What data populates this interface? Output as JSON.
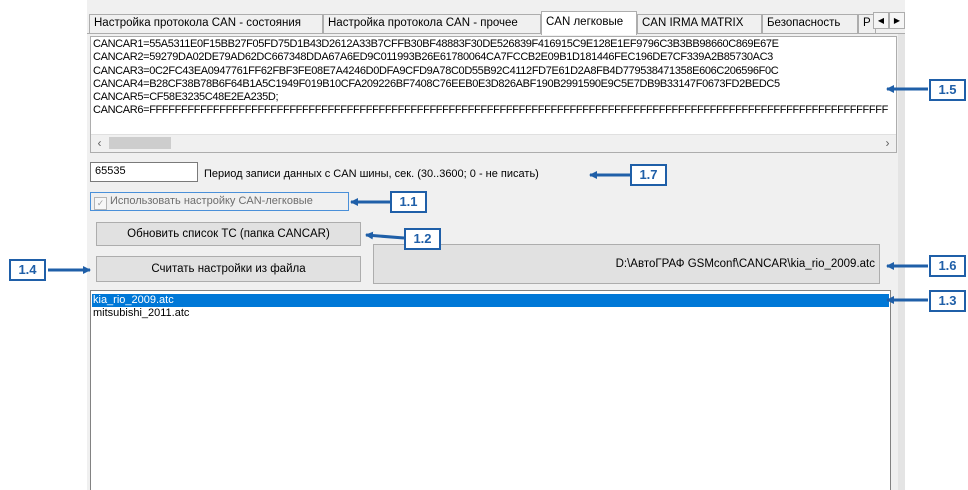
{
  "tabs": [
    {
      "label": "Настройка протокола CAN - состояния",
      "active": false
    },
    {
      "label": "Настройка протокола CAN - прочее",
      "active": false
    },
    {
      "label": "CAN легковые",
      "active": true
    },
    {
      "label": "CAN IRMA MATRIX",
      "active": false
    },
    {
      "label": "Безопасность",
      "active": false
    },
    {
      "label": "P",
      "active": false
    }
  ],
  "tab_scroll": {
    "left": "◀",
    "right": "▶"
  },
  "code_lines": [
    "CANCAR1=55A5311E0F15BB27F05FD75D1B43D2612A33B7CFFB30BF48883F30DE526839F416915C9E128E1EF9796C3B3BB98660C869E67E",
    "CANCAR2=59279DA02DE79AD62DC667348DDA67A6ED9C011993B26E61780064CA7FCCB2E09B1D181446FEC196DE7CF339A2B85730AC3",
    "CANCAR3=0C2FC43EA0947761FF62FBF3FE08E7A4246D0DFA9CFD9A78C0D55B92C4112FD7E61D2A8FB4D779538471358E606C206596F0C",
    "CANCAR4=B28CF38B78B6F64B1A5C1949F019B10CFA209226BF7408C76EEB0E3D826ABF190B2991590E9C5E7DB9B33147F0673FD2BEDC5",
    "CANCAR5=CF58E3235C48E2EA235D;",
    "CANCAR6=FFFFFFFFFFFFFFFFFFFFFFFFFFFFFFFFFFFFFFFFFFFFFFFFFFFFFFFFFFFFFFFFFFFFFFFFFFFFFFFFFFFFFFFFFFFFFFFFFFFFFFFFFFFFFFFFFFFF"
  ],
  "scroll": {
    "left": "‹",
    "right": "›"
  },
  "period": {
    "value": "65535",
    "label": "Период записи данных с CAN шины, сек. (30..3600; 0 - не писать)"
  },
  "checkbox": {
    "label": "Использовать настройку CAN-легковые",
    "checked": true,
    "mark": "✓"
  },
  "buttons": {
    "update": "Обновить список ТС (папка CANCAR)",
    "read": "Считать настройки из файла",
    "path": "D:\\АвтоГРАФ GSMconf\\CANCAR\\kia_rio_2009.atc"
  },
  "files": [
    {
      "name": "kia_rio_2009.atc",
      "selected": true
    },
    {
      "name": "mitsubishi_2011.atc",
      "selected": false
    }
  ],
  "callouts": {
    "c1_1": "1.1",
    "c1_2": "1.2",
    "c1_3": "1.3",
    "c1_4": "1.4",
    "c1_5": "1.5",
    "c1_6": "1.6",
    "c1_7": "1.7"
  },
  "colors": {
    "accent": "#1f5fa8",
    "selection": "#0078d7"
  }
}
